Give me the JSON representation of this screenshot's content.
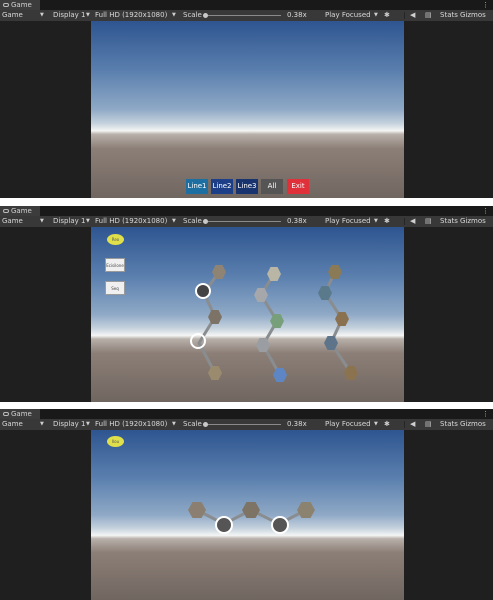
{
  "editor": {
    "tab_title": "Game",
    "game_dropdown": "Game",
    "display_dropdown": "Display 1",
    "resolution_dropdown": "Full HD (1920x1080)",
    "scale_label": "Scale",
    "scale_value": "0.38x",
    "play_mode": "Play Focused",
    "stats_label": "Stats",
    "gizmos_label": "Gizmos",
    "kebab": "⋮"
  },
  "panel1": {
    "buttons": [
      {
        "label": "Line1",
        "color": "#1c6fa0"
      },
      {
        "label": "Line2",
        "color": "#1c3f88"
      },
      {
        "label": "Line3",
        "color": "#19336e"
      },
      {
        "label": "All",
        "color": "#555555"
      },
      {
        "label": "Exit",
        "color": "#e0303a"
      }
    ]
  },
  "panel2": {
    "yellow_button": "Reo",
    "white_buttons": [
      "Ecisilone",
      "Seq"
    ],
    "columns": [
      "bronze-gear-tokens",
      "blue-silver-tokens",
      "hex-tile-tokens"
    ]
  },
  "panel3": {
    "yellow_button": "Ilou"
  },
  "colors": {
    "editor_bg": "#1f1f1f",
    "toolbar_bg": "#383838",
    "sky_top": "#2e5590",
    "horizon": "#f4f5f4",
    "ground": "#706660"
  }
}
